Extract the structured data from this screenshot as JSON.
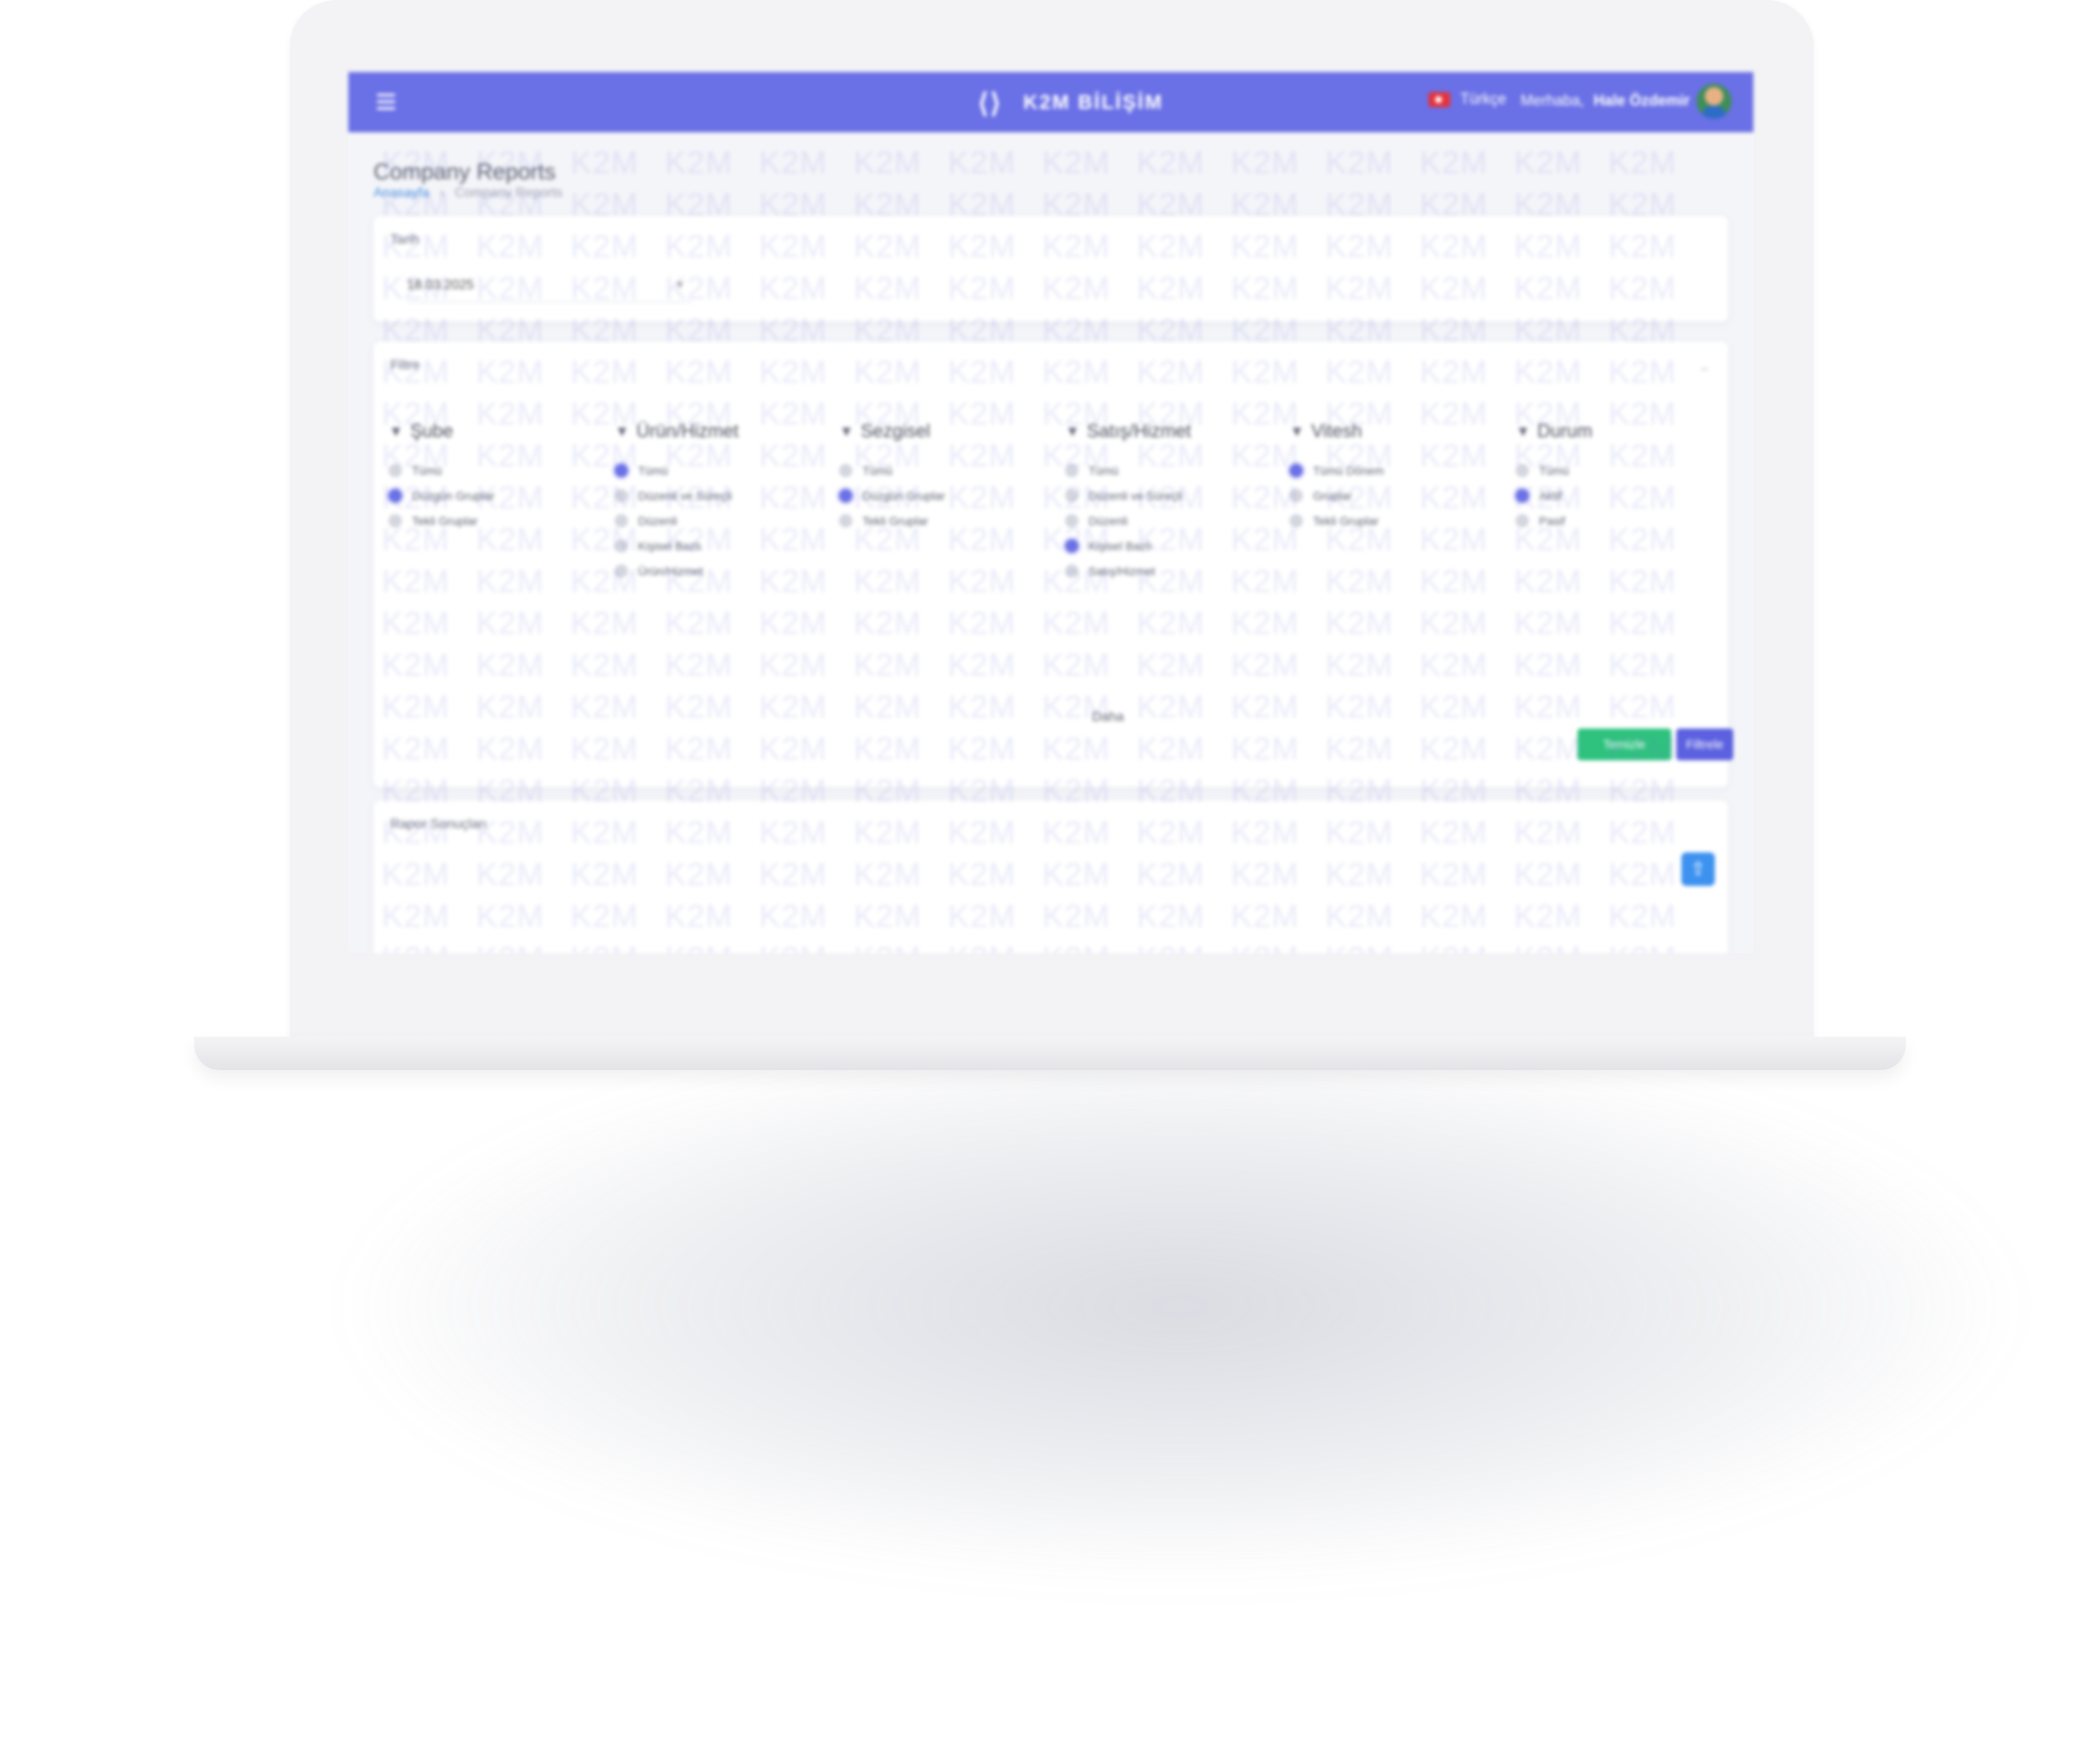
{
  "navbar": {
    "brand": "K2M BİLİŞİM",
    "language": "Türkçe",
    "welcome_prefix": "Merhaba,",
    "user_name": "Hale Özdemir"
  },
  "page": {
    "title": "Company Reports",
    "breadcrumb": [
      "Anasayfa",
      "Company Reports"
    ]
  },
  "date_card": {
    "title": "Tarih",
    "date_value": "18.03.2025"
  },
  "filter_card": {
    "title": "Filtre",
    "columns": [
      {
        "header": "Şube",
        "options": [
          {
            "label": "Tümü",
            "checked": false
          },
          {
            "label": "Düzgün Gruplar",
            "checked": true
          },
          {
            "label": "Tekli Gruplar",
            "checked": false
          }
        ]
      },
      {
        "header": "Ürün/Hizmet",
        "options": [
          {
            "label": "Tümü",
            "checked": true
          },
          {
            "label": "Düzenli ve Süreçli",
            "checked": false
          },
          {
            "label": "Düzenli",
            "checked": false
          },
          {
            "label": "Kişisel Bazlı",
            "checked": false
          },
          {
            "label": "Ürün/Hizmet",
            "checked": false
          }
        ]
      },
      {
        "header": "Sezgisel",
        "options": [
          {
            "label": "Tümü",
            "checked": false
          },
          {
            "label": "Düzgün Gruplar",
            "checked": true
          },
          {
            "label": "Tekli Gruplar",
            "checked": false
          }
        ]
      },
      {
        "header": "Satış/Hizmet",
        "options": [
          {
            "label": "Tümü",
            "checked": false
          },
          {
            "label": "Düzenli ve Süreçli",
            "checked": false
          },
          {
            "label": "Düzenli",
            "checked": false
          },
          {
            "label": "Kişisel Bazlı",
            "checked": true
          },
          {
            "label": "Satış/Hizmet",
            "checked": false
          }
        ]
      },
      {
        "header": "Vitesh",
        "options": [
          {
            "label": "Tümü Dönem",
            "checked": true
          },
          {
            "label": "Gruplar",
            "checked": false
          },
          {
            "label": "Tekli Gruplar",
            "checked": false
          }
        ]
      },
      {
        "header": "Durum",
        "options": [
          {
            "label": "Tümü",
            "checked": false
          },
          {
            "label": "Aktif",
            "checked": true
          },
          {
            "label": "Pasif",
            "checked": false
          }
        ]
      }
    ],
    "more_label": "Daha",
    "reset_label": "Temizle",
    "filter_label": "Filtrele"
  },
  "results_card": {
    "title": "Rapor Sonuçları"
  },
  "watermark_text": "K2M",
  "colors": {
    "primary": "#6a70e6",
    "success": "#2ec27e",
    "info": "#3d92f0"
  }
}
